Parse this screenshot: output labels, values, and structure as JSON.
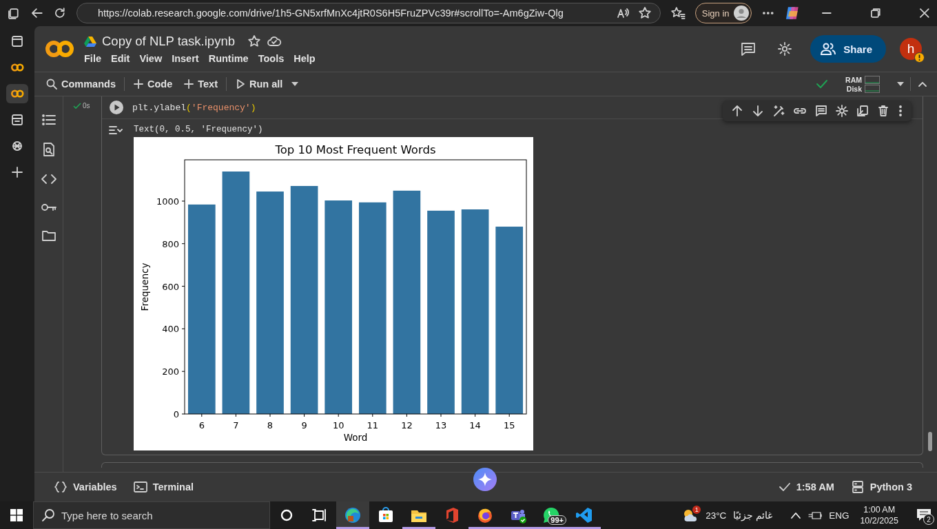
{
  "browser": {
    "url": "https://colab.research.google.com/drive/1h5-GN5xrfMnXc4jtR0S6H5FruZPVc39r#scrollTo=-Am6gZiw-Qlg",
    "sign_in": "Sign in"
  },
  "notebook": {
    "title": "Copy of NLP task.ipynb"
  },
  "menu": [
    "File",
    "Edit",
    "View",
    "Insert",
    "Runtime",
    "Tools",
    "Help"
  ],
  "header": {
    "share": "Share",
    "avatar": "h"
  },
  "toolbar": {
    "commands": "Commands",
    "add_code": "Code",
    "add_text": "Text",
    "run_all": "Run all",
    "ram": "RAM",
    "disk": "Disk"
  },
  "cell": {
    "exec_time": "0s",
    "code": [
      {
        "kind": "plain",
        "text": "plt.ylabel"
      },
      {
        "kind": "paren",
        "text": "("
      },
      {
        "kind": "string",
        "text": "'Frequency'"
      },
      {
        "kind": "paren",
        "text": ")"
      }
    ],
    "output_text": "Text(0, 0.5, 'Frequency')",
    "chart_data": {
      "type": "bar",
      "title": "Top 10 Most Frequent Words",
      "xlabel": "Word",
      "ylabel": "Frequency",
      "categories": [
        "6",
        "7",
        "8",
        "9",
        "10",
        "11",
        "12",
        "13",
        "14",
        "15"
      ],
      "series": [
        {
          "color": "#3274a1",
          "values": [
            984,
            1139,
            1045,
            1071,
            1003,
            994,
            1049,
            955,
            961,
            880
          ]
        }
      ],
      "ylim": [
        0,
        1194
      ],
      "yticks": [
        0,
        200,
        400,
        600,
        800,
        1000
      ]
    }
  },
  "status_bar": {
    "variables": "Variables",
    "terminal": "Terminal",
    "last_run": "1:58 AM",
    "runtime": "Python 3"
  },
  "taskbar": {
    "search_placeholder": "Type here to search",
    "apps": [
      {
        "kind": "browser",
        "running": true,
        "selected": true
      },
      {
        "kind": "store",
        "running": false,
        "selected": false
      },
      {
        "kind": "folder",
        "running": true,
        "selected": false
      },
      {
        "kind": "office",
        "running": false,
        "selected": false
      },
      {
        "kind": "fox",
        "running": true,
        "selected": false
      },
      {
        "kind": "teams",
        "running": true,
        "selected": false
      },
      {
        "kind": "chat",
        "running": true,
        "selected": false,
        "badge": "99+"
      },
      {
        "kind": "editor",
        "running": true,
        "selected": false
      }
    ],
    "weather_badge": "1",
    "temperature": "23°C",
    "weather": "غائم جزئيًا",
    "language": "ENG",
    "time": "1:00 AM",
    "date": "10/2/2025",
    "notifications": "2"
  }
}
